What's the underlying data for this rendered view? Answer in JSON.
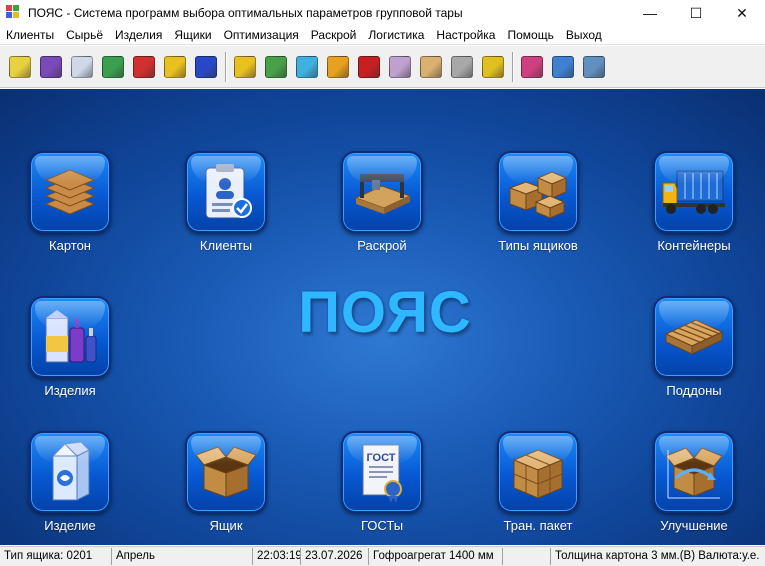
{
  "window": {
    "title": "ПОЯС - Система программ выбора оптимальных параметров групповой тары",
    "controls": {
      "minimize": "—",
      "maximize": "☐",
      "close": "✕"
    }
  },
  "menu": [
    "Клиенты",
    "Сырьё",
    "Изделия",
    "Ящики",
    "Оптимизация",
    "Раскрой",
    "Логистика",
    "Настройка",
    "Помощь",
    "Выход"
  ],
  "toolbar": {
    "groups": [
      [
        {
          "icon": "paper-roll-icon",
          "color": "#e8d040"
        },
        {
          "icon": "factory-icon",
          "color": "#7a4ab8"
        },
        {
          "icon": "form-icon",
          "color": "#d0d8e8"
        },
        {
          "icon": "cycle-icon",
          "color": "#3aa050"
        },
        {
          "icon": "bottles-icon",
          "color": "#d03030"
        },
        {
          "icon": "box-lightning-icon",
          "color": "#e8c020"
        },
        {
          "icon": "flask-icon",
          "color": "#2848c8"
        }
      ],
      [
        {
          "icon": "box-blue-icon",
          "color": "#e8c020"
        },
        {
          "icon": "box-multi-icon",
          "color": "#48a048"
        },
        {
          "icon": "crystal-icon",
          "color": "#40b0e0"
        },
        {
          "icon": "bricks-icon",
          "color": "#e8a020"
        },
        {
          "icon": "download-red-icon",
          "color": "#c82020"
        },
        {
          "icon": "pallet-stack-icon",
          "color": "#c0a0d0"
        },
        {
          "icon": "carton-stack-icon",
          "color": "#d8b070"
        },
        {
          "icon": "barrel-icon",
          "color": "#a8a8a8"
        },
        {
          "icon": "forklift-icon",
          "color": "#e0c020"
        }
      ],
      [
        {
          "icon": "grid-icon",
          "color": "#d04080"
        },
        {
          "icon": "chart-ab-icon",
          "color": "#4080d0"
        },
        {
          "icon": "report-icon",
          "color": "#6090c0"
        }
      ]
    ]
  },
  "main": {
    "logo": "ПОЯС",
    "tiles": [
      {
        "label": "Картон",
        "icon": "cardboard-sheets-icon"
      },
      {
        "label": "Клиенты",
        "icon": "client-clipboard-icon"
      },
      {
        "label": "Раскрой",
        "icon": "cutting-machine-icon"
      },
      {
        "label": "Типы ящиков",
        "icon": "box-types-icon"
      },
      {
        "label": "Контейнеры",
        "icon": "container-truck-icon"
      },
      {
        "label": "Изделия",
        "icon": "products-bottles-icon"
      },
      {
        "label": "Поддоны",
        "icon": "pallet-icon"
      },
      {
        "label": "Изделие",
        "icon": "milk-carton-icon"
      },
      {
        "label": "Ящик",
        "icon": "open-box-icon"
      },
      {
        "label": "ГОСТы",
        "icon": "gost-certificate-icon"
      },
      {
        "label": "Тран. пакет",
        "icon": "transport-pack-icon"
      },
      {
        "label": "Улучшение",
        "icon": "box-improvement-icon"
      }
    ]
  },
  "status": {
    "box_type": "Тип ящика: 0201",
    "month": "Апрель",
    "time": "22:03:19",
    "date": "23.07.2026",
    "corrugator": "Гофроагрегат 1400 мм",
    "empty": "",
    "thickness": "Толщина картона 3 мм.(В) Валюта:у.е."
  }
}
